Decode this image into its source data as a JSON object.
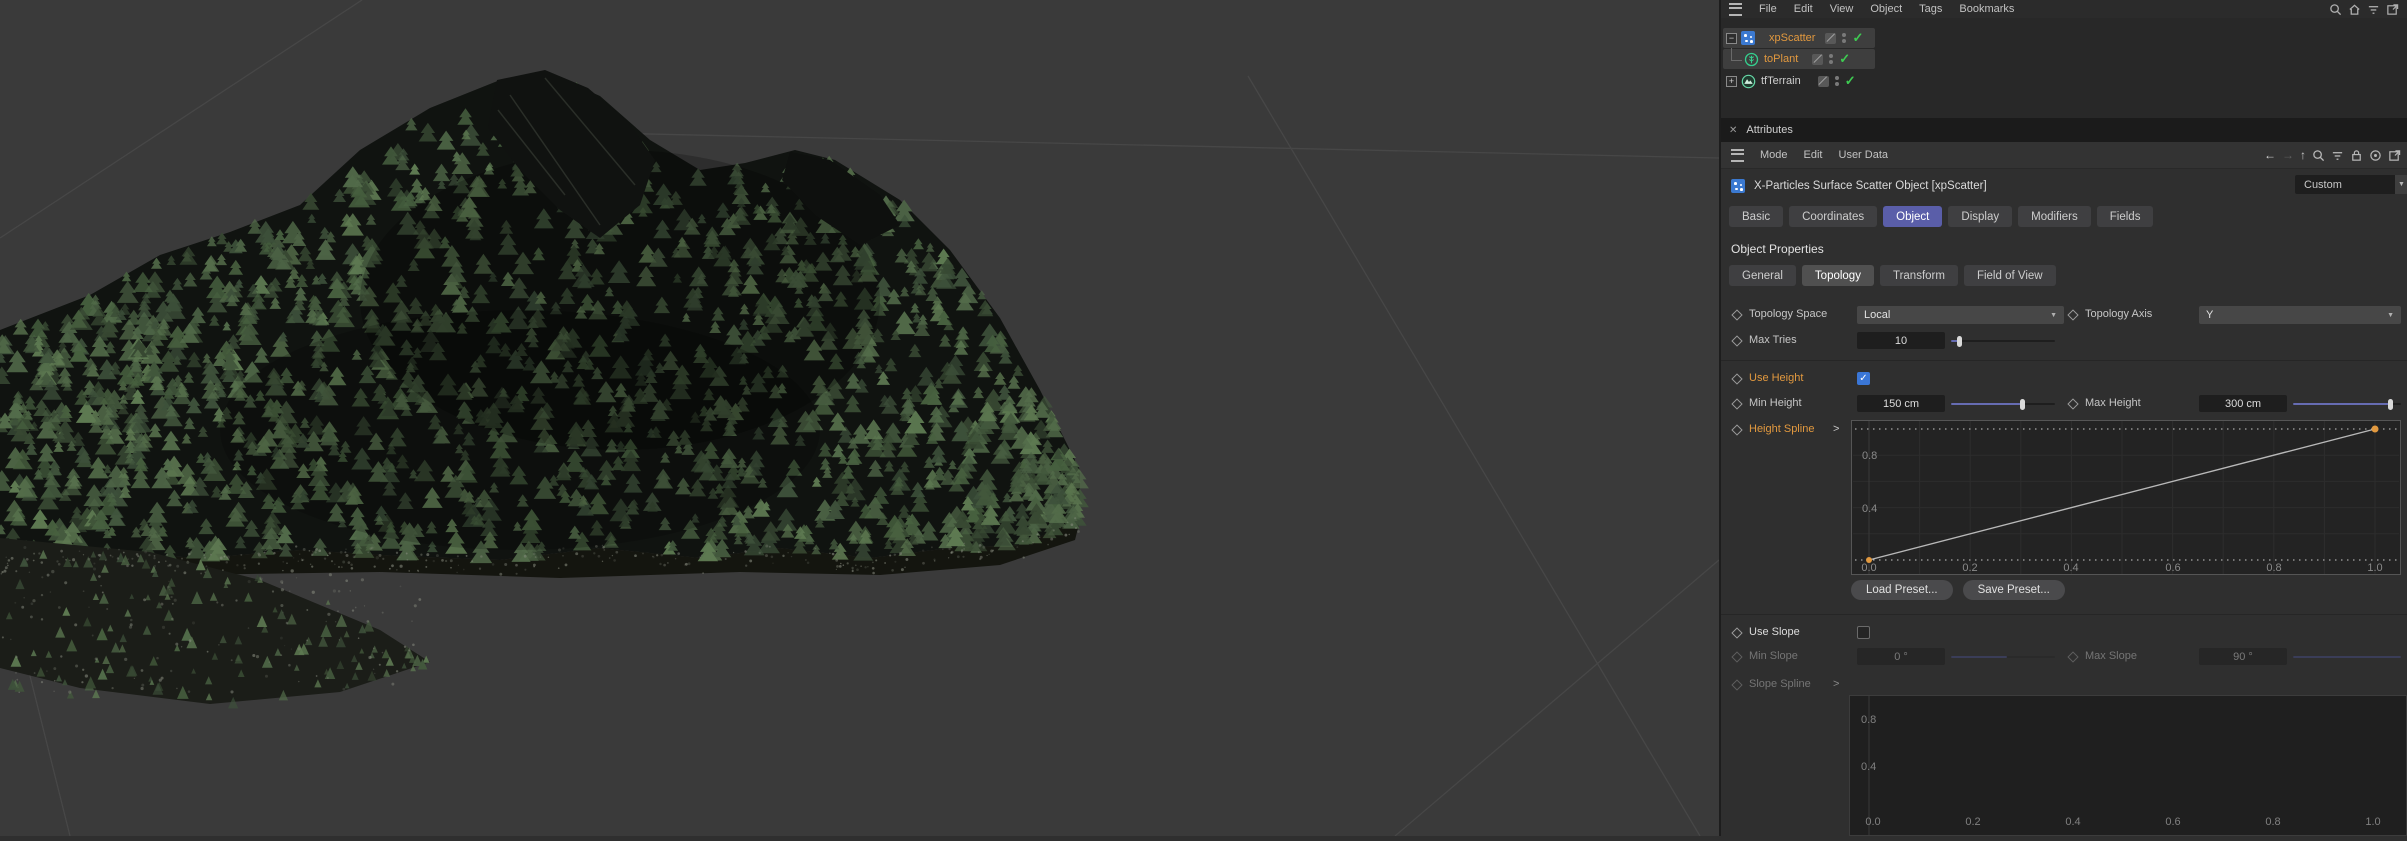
{
  "colors": {
    "accent_orange": "#e2993f",
    "active_tab_blue": "#5a5ea9",
    "slider_fill_blue": "#666cb2",
    "checkbox_blue": "#3a76d6",
    "enabled_check_green": "#3ecb52"
  },
  "top_menu": {
    "items": [
      "File",
      "Edit",
      "View",
      "Object",
      "Tags",
      "Bookmarks"
    ],
    "right_icons": [
      "search-icon",
      "home-icon",
      "filter-icon",
      "undock-icon"
    ]
  },
  "object_manager": {
    "rows": [
      {
        "label": "xpScatter",
        "icon": "xparticles-scatter",
        "expanded": "-",
        "selected": true,
        "enabled_check": true
      },
      {
        "label": "toPlant",
        "icon": "plant",
        "child": true,
        "selected": true,
        "enabled_check": true
      },
      {
        "label": "tfTerrain",
        "icon": "terrain",
        "expanded": "+",
        "selected": false,
        "enabled_check": true
      }
    ]
  },
  "attributes_panel": {
    "title": "Attributes",
    "menu_items": [
      "Mode",
      "Edit",
      "User Data"
    ],
    "object_header": {
      "title": "X-Particles Surface Scatter Object [xpScatter]",
      "preset_value": "Custom"
    },
    "tabs": {
      "items": [
        "Basic",
        "Coordinates",
        "Object",
        "Display",
        "Modifiers",
        "Fields"
      ],
      "active": "Object"
    },
    "section_heading": "Object Properties",
    "subtabs": {
      "items": [
        "General",
        "Topology",
        "Transform",
        "Field of View"
      ],
      "active": "Topology"
    },
    "fields": {
      "topology_space": {
        "label": "Topology Space",
        "value": "Local"
      },
      "topology_axis": {
        "label": "Topology Axis",
        "value": "Y"
      },
      "max_tries": {
        "label": "Max Tries",
        "value": "10"
      },
      "use_height": {
        "label": "Use Height",
        "checked": true
      },
      "min_height": {
        "label": "Min Height",
        "value": "150 cm"
      },
      "max_height": {
        "label": "Max Height",
        "value": "300 cm"
      },
      "height_spline": {
        "label": "Height Spline"
      },
      "use_slope": {
        "label": "Use Slope",
        "checked": false
      },
      "min_slope": {
        "label": "Min Slope",
        "value": "0 °",
        "disabled": true
      },
      "max_slope": {
        "label": "Max Slope",
        "value": "90 °",
        "disabled": true
      },
      "slope_spline": {
        "label": "Slope Spline",
        "disabled": true
      }
    },
    "preset_buttons": {
      "load": "Load Preset...",
      "save": "Save Preset..."
    }
  },
  "chart_data": [
    {
      "type": "line",
      "title": "Height Spline",
      "x": [
        0.0,
        1.0
      ],
      "y": [
        0.0,
        1.0
      ],
      "x_ticks": [
        "0.0",
        "0.2",
        "0.4",
        "0.6",
        "0.8",
        "1.0"
      ],
      "y_ticks": [
        "0.8",
        "0.4"
      ],
      "xlim": [
        0,
        1
      ],
      "ylim": [
        0,
        1
      ],
      "grid": true,
      "point_color": "#e2993f",
      "note": "linear curve from (0,0) to (1,1), endpoints marked with orange control points, dotted lines at y=0 and y=1"
    },
    {
      "type": "line",
      "title": "Slope Spline",
      "x": [],
      "y": [],
      "x_ticks": [
        "0.0",
        "0.2",
        "0.4",
        "0.6",
        "0.8",
        "1.0"
      ],
      "y_ticks": [
        "0.8",
        "0.4"
      ],
      "xlim": [
        0,
        1
      ],
      "ylim": [
        0,
        1
      ],
      "grid": false,
      "disabled": true,
      "note": "empty disabled spline area, cut off at window bottom"
    }
  ]
}
